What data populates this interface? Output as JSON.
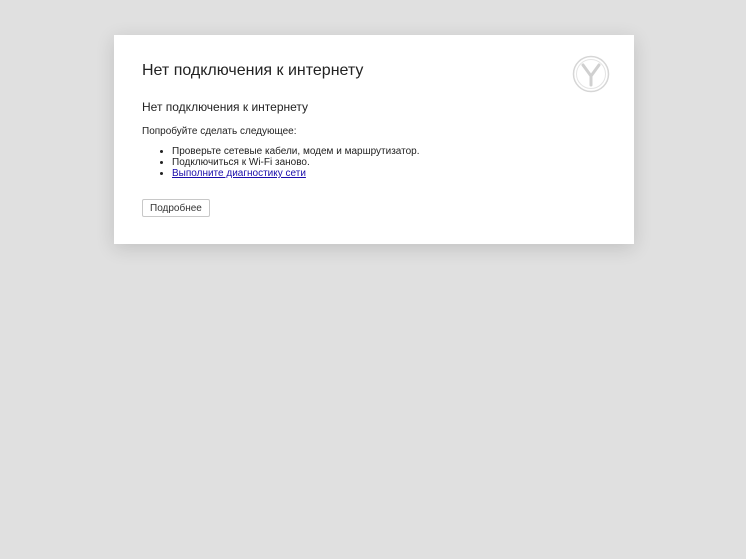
{
  "page": {
    "title": "Нет подключения к интернету",
    "subtitle": "Нет подключения к интернету",
    "try_label": "Попробуйте сделать следующее:",
    "suggestions": [
      "Проверьте сетевые кабели, модем и маршрутизатор.",
      "Подключиться к Wi-Fi заново."
    ],
    "diagnostics_link": "Выполните диагностику сети",
    "details_button": "Подробнее"
  },
  "logo": {
    "icon": "yandex-browser-logo-icon"
  },
  "colors": {
    "background": "#e0e0e0",
    "card": "#ffffff",
    "link": "#1a0dab"
  }
}
